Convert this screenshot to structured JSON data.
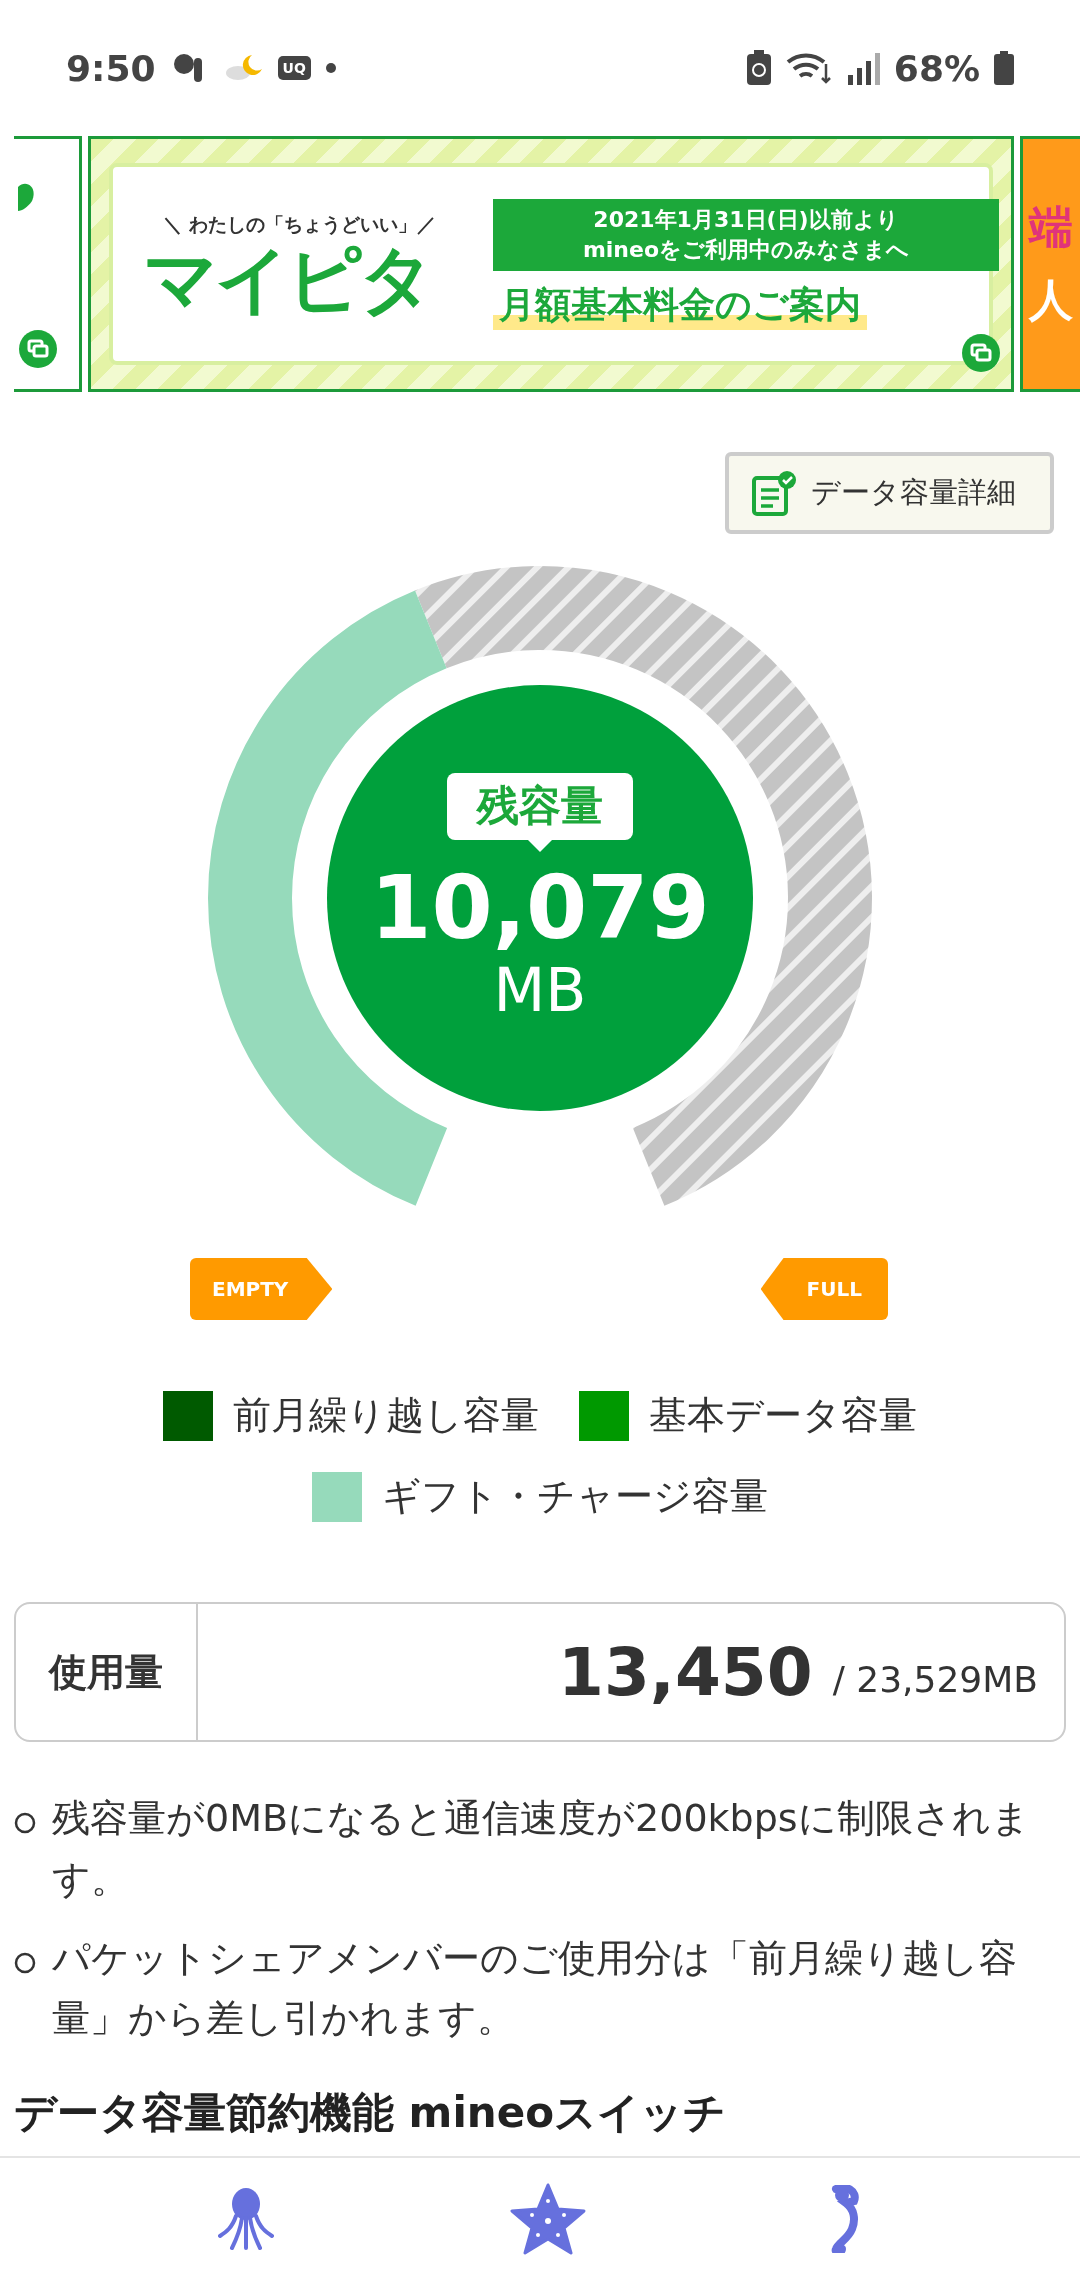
{
  "status_bar": {
    "time": "9:50",
    "carrier_badge": "UQ",
    "battery": "68%"
  },
  "banner": {
    "tagline": "＼ わたしの「ちょうどいい」／",
    "logo": "マイピタ",
    "date_line": "**2021**年**1**月**31**日(日)以前より",
    "notice": "mineoをご利用中のみなさまへ",
    "headline": "月額基本料金のご案内",
    "next_banner": [
      "端",
      "人"
    ]
  },
  "detail_button": {
    "label": "データ容量詳細"
  },
  "gauge": {
    "caption": "残容量",
    "value": "10,079",
    "unit": "MB",
    "start_label": "EMPTY",
    "end_label": "FULL"
  },
  "legend": [
    {
      "label": "前月繰り越し容量",
      "color": "#005a00"
    },
    {
      "label": "基本データ容量",
      "color": "#009900"
    },
    {
      "label": "ギフト・チャージ容量",
      "color": "#96dabb"
    }
  ],
  "usage": {
    "label": "使用量",
    "used": "13,450",
    "total": "/ 23,529MB"
  },
  "notes": [
    "残容量が0MBになると通信速度が200kbpsに制限されます。",
    "パケットシェアメンバーのご使用分は「前月繰り越し容量」から差し引かれます。"
  ],
  "section_heading": "データ容量節約機能 mineoスイッチ"
}
